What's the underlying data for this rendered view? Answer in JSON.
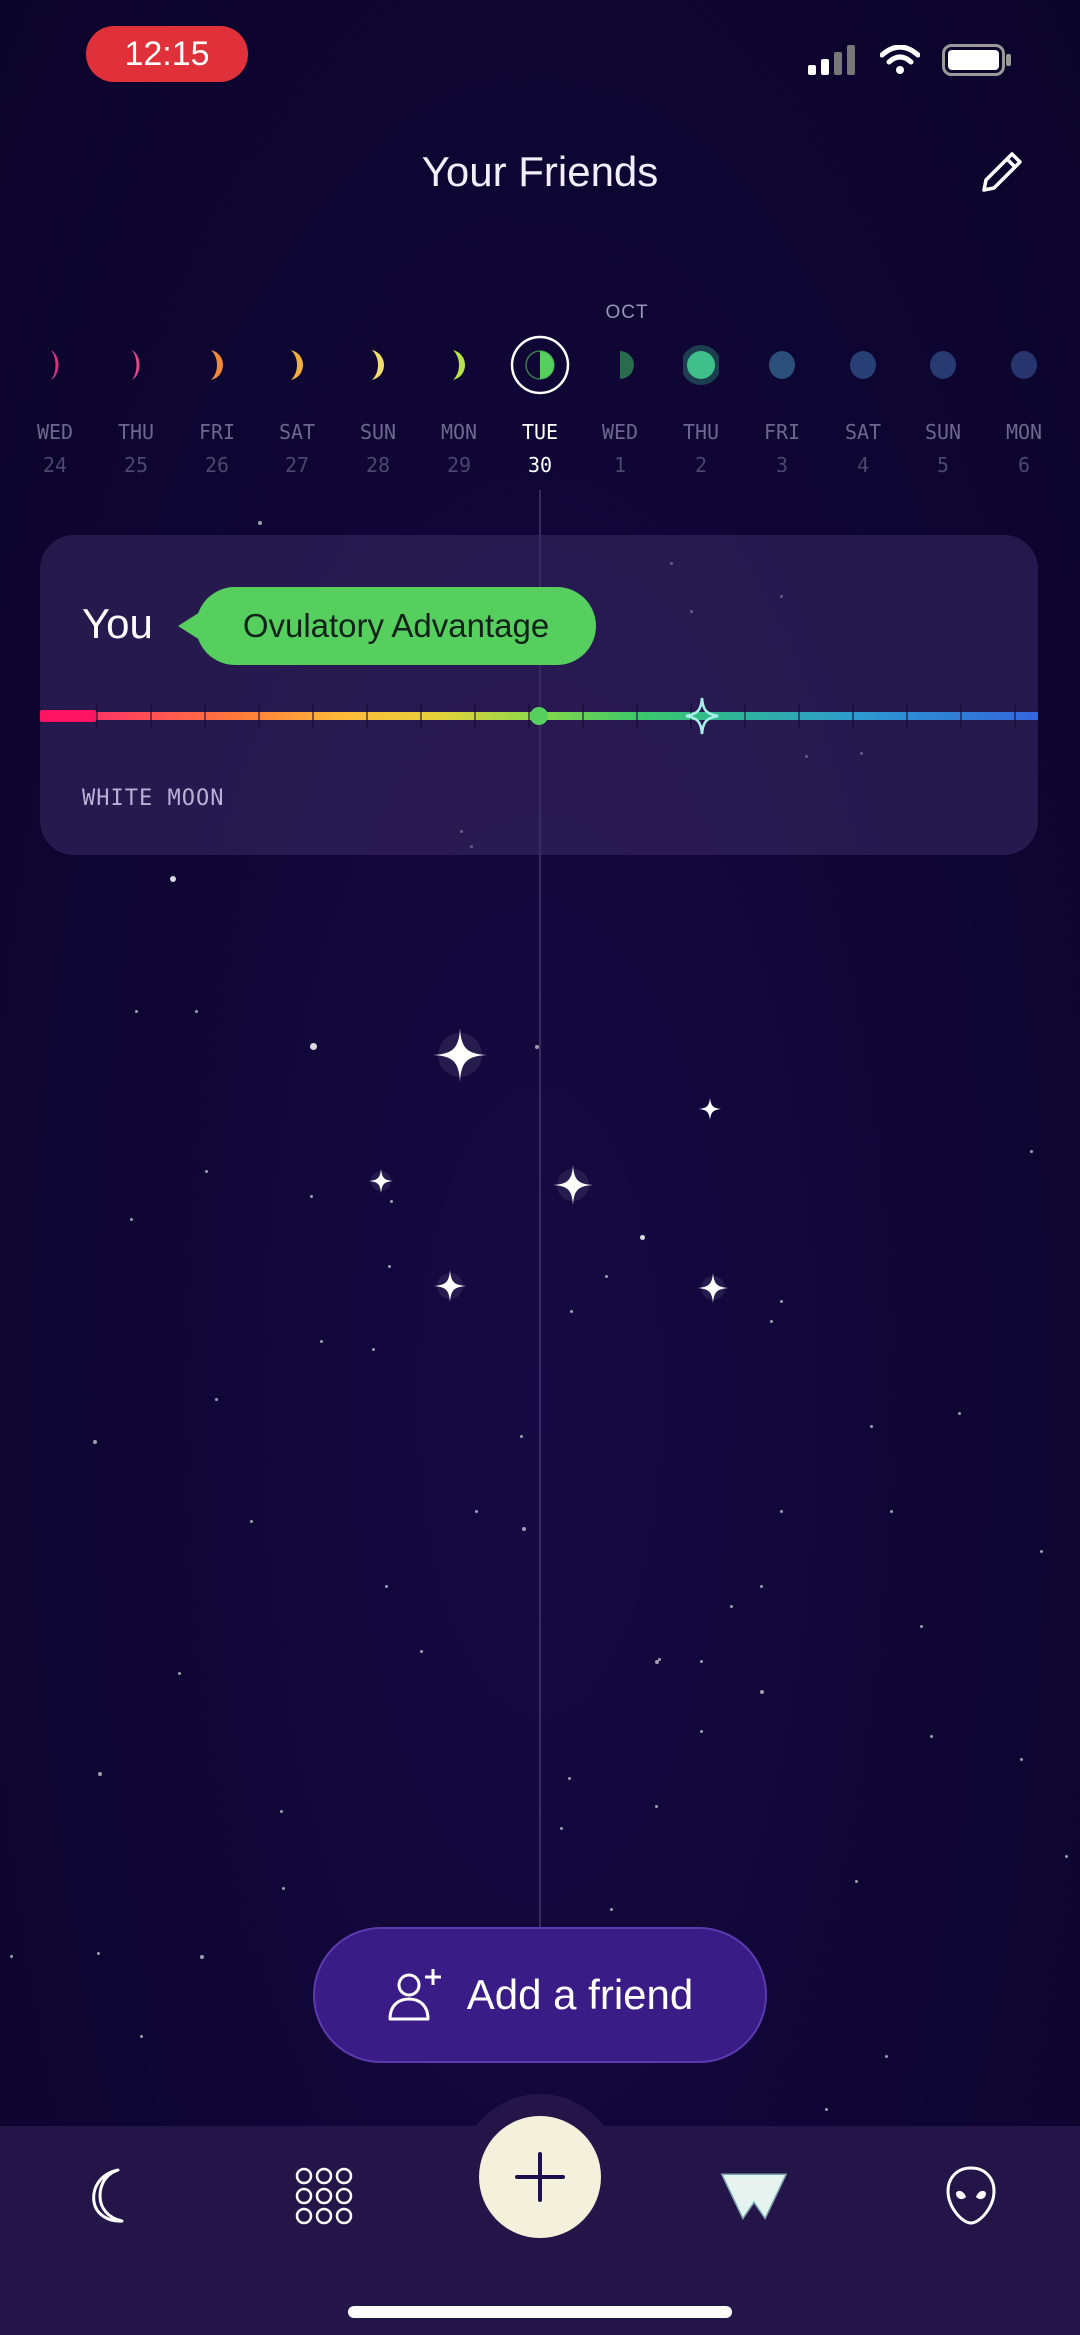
{
  "status_bar": {
    "time": "12:15"
  },
  "header": {
    "title": "Your Friends",
    "edit_icon": "pencil-icon"
  },
  "calendar": {
    "month_label": "OCT",
    "days": [
      {
        "name": "WED",
        "num": "24",
        "moon": "thin-crescent",
        "color": "#d8327e"
      },
      {
        "name": "THU",
        "num": "25",
        "moon": "thin-crescent",
        "color": "#e04a8c"
      },
      {
        "name": "FRI",
        "num": "26",
        "moon": "crescent",
        "color": "#ef8a3c"
      },
      {
        "name": "SAT",
        "num": "27",
        "moon": "crescent",
        "color": "#f0b040"
      },
      {
        "name": "SUN",
        "num": "28",
        "moon": "crescent",
        "color": "#f0dd70"
      },
      {
        "name": "MON",
        "num": "29",
        "moon": "crescent",
        "color": "#b6e24a"
      },
      {
        "name": "TUE",
        "num": "30",
        "moon": "first-quarter",
        "color": "#56cf5e",
        "today": true
      },
      {
        "name": "WED",
        "num": "1",
        "moon": "first-quarter",
        "color": "#2a6a4e"
      },
      {
        "name": "THU",
        "num": "2",
        "moon": "full",
        "color": "#3fbf8a",
        "highlight": true
      },
      {
        "name": "FRI",
        "num": "3",
        "moon": "gibbous",
        "color": "#2a4f7a"
      },
      {
        "name": "SAT",
        "num": "4",
        "moon": "gibbous",
        "color": "#283f76"
      },
      {
        "name": "SUN",
        "num": "5",
        "moon": "gibbous",
        "color": "#283a72"
      },
      {
        "name": "MON",
        "num": "6",
        "moon": "gibbous",
        "color": "#28346e"
      }
    ]
  },
  "card": {
    "you_label": "You",
    "phase": "Ovulatory Advantage",
    "phase_color": "#56cf5e",
    "moon_type": "WHITE MOON"
  },
  "add_friend": {
    "label": "Add a friend",
    "icon": "add-person-icon"
  },
  "tab_bar": {
    "items": [
      "moon-icon",
      "grid-icon",
      "plus-icon",
      "crown-icon",
      "alien-icon"
    ]
  }
}
